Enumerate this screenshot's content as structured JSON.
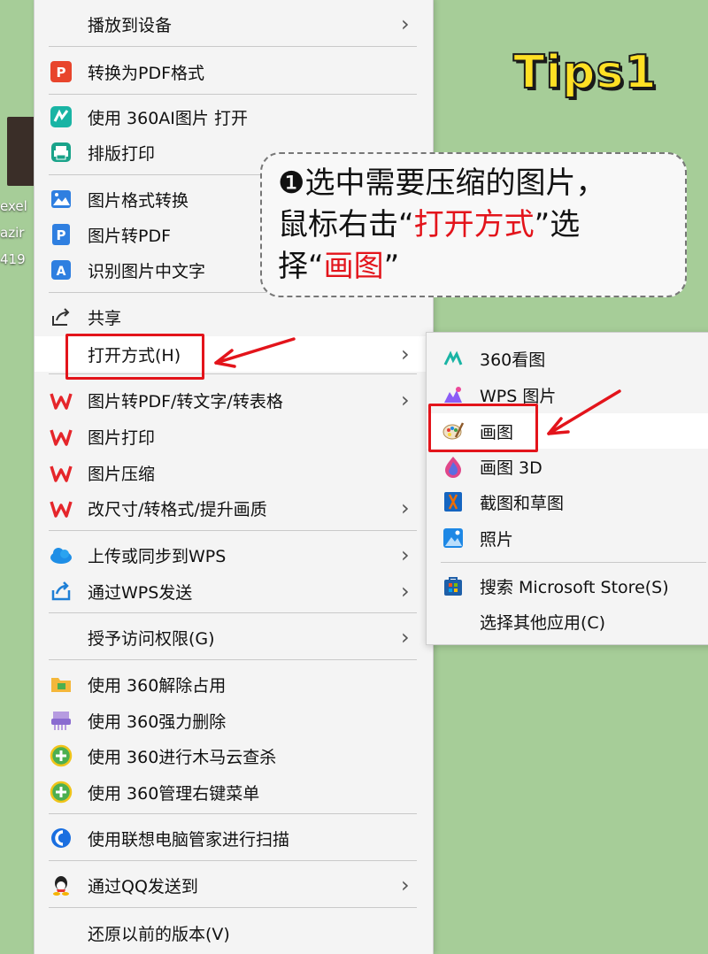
{
  "desktop": {
    "lines": [
      "exel",
      "azir",
      "419"
    ]
  },
  "menu": {
    "items": [
      {
        "label": "播放到设备",
        "icon": "",
        "arrow": true
      },
      {
        "label": "转换为PDF格式",
        "icon": "pdf-convert-icon",
        "arrow": false
      },
      {
        "label": "使用 360AI图片 打开",
        "icon": "360ai-icon",
        "arrow": false
      },
      {
        "label": "排版打印",
        "icon": "printer-icon",
        "arrow": false
      },
      {
        "label": "图片格式转换",
        "icon": "image-icon",
        "arrow": false
      },
      {
        "label": "图片转PDF",
        "icon": "pdf-p-icon",
        "arrow": false
      },
      {
        "label": "识别图片中文字",
        "icon": "ocr-icon",
        "arrow": false
      },
      {
        "label": "共享",
        "icon": "share-icon",
        "arrow": false
      },
      {
        "label": "打开方式(H)",
        "icon": "",
        "arrow": true
      },
      {
        "label": "图片转PDF/转文字/转表格",
        "icon": "wps-icon",
        "arrow": true
      },
      {
        "label": "图片打印",
        "icon": "wps-icon",
        "arrow": false
      },
      {
        "label": "图片压缩",
        "icon": "wps-icon",
        "arrow": false
      },
      {
        "label": "改尺寸/转格式/提升画质",
        "icon": "wps-icon",
        "arrow": true
      },
      {
        "label": "上传或同步到WPS",
        "icon": "cloud-icon",
        "arrow": true
      },
      {
        "label": "通过WPS发送",
        "icon": "send-icon",
        "arrow": true
      },
      {
        "label": "授予访问权限(G)",
        "icon": "",
        "arrow": true
      },
      {
        "label": "使用 360解除占用",
        "icon": "folder-unlock-icon",
        "arrow": false
      },
      {
        "label": "使用 360强力删除",
        "icon": "shredder-icon",
        "arrow": false
      },
      {
        "label": "使用 360进行木马云查杀",
        "icon": "360-shield-icon",
        "arrow": false
      },
      {
        "label": "使用 360管理右键菜单",
        "icon": "360-shield-icon",
        "arrow": false
      },
      {
        "label": "使用联想电脑管家进行扫描",
        "icon": "lenovo-icon",
        "arrow": false
      },
      {
        "label": "通过QQ发送到",
        "icon": "qq-icon",
        "arrow": true
      },
      {
        "label": "还原以前的版本(V)",
        "icon": "",
        "arrow": false
      }
    ]
  },
  "submenu": {
    "items": [
      {
        "label": "360看图",
        "icon": "360-viewer-icon"
      },
      {
        "label": "WPS 图片",
        "icon": "wps-photo-icon"
      },
      {
        "label": "画图",
        "icon": "paint-palette-icon"
      },
      {
        "label": "画图 3D",
        "icon": "paint3d-icon"
      },
      {
        "label": "截图和草图",
        "icon": "snip-sketch-icon"
      },
      {
        "label": "照片",
        "icon": "photos-icon"
      },
      {
        "label": "搜索 Microsoft Store(S)",
        "icon": "store-icon"
      },
      {
        "label": "选择其他应用(C)",
        "icon": ""
      }
    ]
  },
  "overlay": {
    "tips": "Tips1",
    "callout": {
      "line1": "❶选中需要压缩的图片，",
      "line2_a": "鼠标右击“",
      "line2_red": "打开方式",
      "line2_b": "”选",
      "line3_a": "择“",
      "line3_red": "画图",
      "line3_b": "”"
    }
  },
  "colors": {
    "accent_red": "#e3141b",
    "background_green": "#a6cd98",
    "menu_bg": "#f4f4f4"
  }
}
